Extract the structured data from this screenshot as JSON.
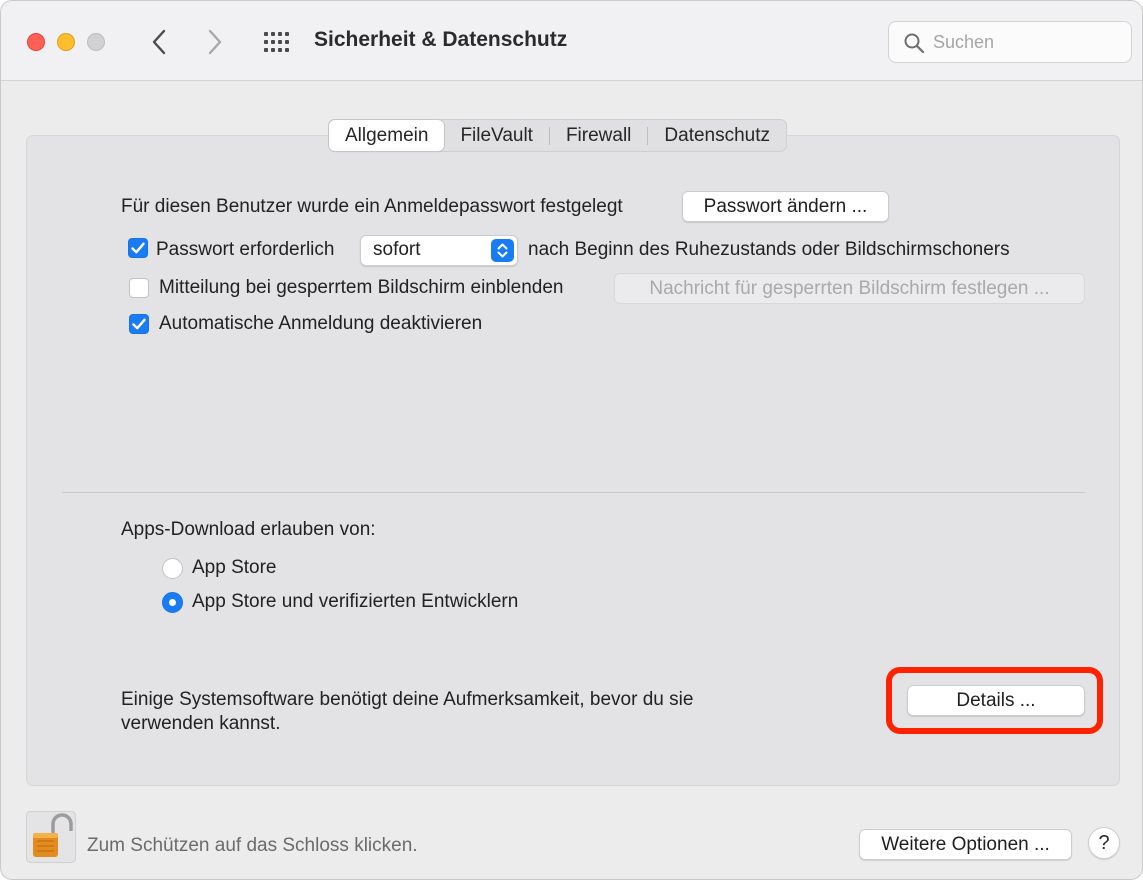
{
  "window": {
    "title": "Sicherheit & Datenschutz"
  },
  "search": {
    "placeholder": "Suchen"
  },
  "tabs": [
    {
      "label": "Allgemein",
      "active": true
    },
    {
      "label": "FileVault",
      "active": false
    },
    {
      "label": "Firewall",
      "active": false
    },
    {
      "label": "Datenschutz",
      "active": false
    }
  ],
  "general": {
    "password_set_text": "Für diesen Benutzer wurde ein Anmeldepasswort festgelegt",
    "change_password_button": "Passwort ändern ...",
    "require_password_label": "Passwort erforderlich",
    "require_password_checked": true,
    "require_password_delay": "sofort",
    "require_password_suffix": "nach Beginn des Ruhezustands oder Bildschirmschoners",
    "lock_message_label": "Mitteilung bei gesperrtem Bildschirm einblenden",
    "lock_message_checked": false,
    "lock_message_button": "Nachricht für gesperrten Bildschirm festlegen ...",
    "auto_login_label": "Automatische Anmeldung deaktivieren",
    "auto_login_checked": true
  },
  "apps_download": {
    "heading": "Apps-Download erlauben von:",
    "options": [
      {
        "label": "App Store",
        "selected": false
      },
      {
        "label": "App Store und verifizierten Entwicklern",
        "selected": true
      }
    ]
  },
  "system_software": {
    "line1": "Einige Systemsoftware benötigt deine Aufmerksamkeit, bevor du sie",
    "line2": "verwenden kannst.",
    "details_button": "Details ...",
    "highlight_color": "#ff2200"
  },
  "footer": {
    "lock_text": "Zum Schützen auf das Schloss klicken.",
    "more_options_button": "Weitere Optionen ...",
    "help_label": "?"
  },
  "colors": {
    "accent": "#1a7cf5"
  }
}
